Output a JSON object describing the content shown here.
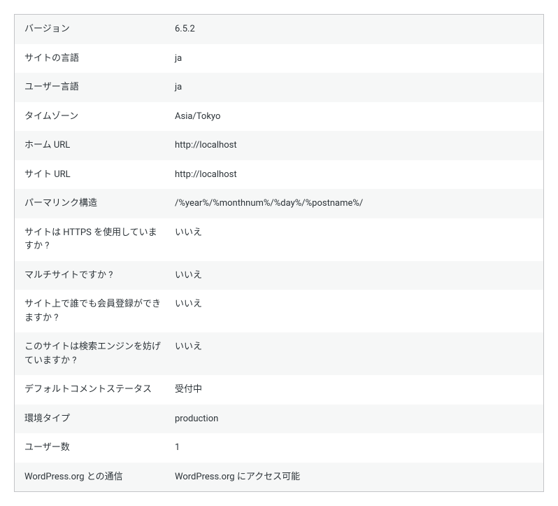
{
  "rows": [
    {
      "label": "バージョン",
      "value": "6.5.2"
    },
    {
      "label": "サイトの言語",
      "value": "ja"
    },
    {
      "label": "ユーザー言語",
      "value": "ja"
    },
    {
      "label": "タイムゾーン",
      "value": "Asia/Tokyo"
    },
    {
      "label": "ホーム URL",
      "value": "http://localhost"
    },
    {
      "label": "サイト URL",
      "value": "http://localhost"
    },
    {
      "label": "パーマリンク構造",
      "value": "/%year%/%monthnum%/%day%/%postname%/"
    },
    {
      "label": "サイトは HTTPS を使用していますか ?",
      "value": "いいえ"
    },
    {
      "label": "マルチサイトですか ?",
      "value": "いいえ"
    },
    {
      "label": "サイト上で誰でも会員登録ができますか ?",
      "value": "いいえ"
    },
    {
      "label": "このサイトは検索エンジンを妨げていますか ?",
      "value": "いいえ"
    },
    {
      "label": "デフォルトコメントステータス",
      "value": "受付中"
    },
    {
      "label": "環境タイプ",
      "value": "production"
    },
    {
      "label": "ユーザー数",
      "value": "1"
    },
    {
      "label": "WordPress.org との通信",
      "value": "WordPress.org にアクセス可能"
    }
  ]
}
